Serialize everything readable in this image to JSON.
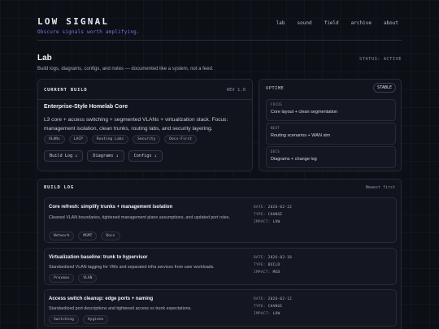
{
  "header": {
    "brand": "LOW SIGNAL",
    "tagline": "Obscure signals worth amplifying.",
    "nav": [
      "lab",
      "sound",
      "field",
      "archive",
      "about"
    ]
  },
  "page": {
    "title": "Lab",
    "subtitle": "Build logs, diagrams, configs, and notes — documented like a system, not a feed.",
    "status": "STATUS: ACTIVE"
  },
  "current_build": {
    "label": "CURRENT BUILD",
    "version": "REV 1.0",
    "title": "Enterprise-Style Homelab Core",
    "description": "L3 core + access switching + segmented VLANs + virtualization stack. Focus: management isolation, clean trunks, routing labs, and security layering.",
    "tags": [
      "VLANs",
      "LACP",
      "Routing Labs",
      "Security",
      "Docs-First"
    ],
    "buttons": [
      "Build Log ↓",
      "Diagrams ↓",
      "Configs ↓"
    ]
  },
  "uptime": {
    "label": "UPTIME",
    "badge": "STABLE",
    "cards": [
      {
        "key": "FOCUS",
        "value": "Core layout + clean segmentation"
      },
      {
        "key": "NEXT",
        "value": "Routing scenarios + WAN sim"
      },
      {
        "key": "DOCS",
        "value": "Diagrams + change log"
      }
    ]
  },
  "build_log": {
    "label": "BUILD LOG",
    "sort": "Newest first",
    "entries": [
      {
        "title": "Core refresh: simplify trunks + management isolation",
        "description": "Cleaned VLAN boundaries, tightened management plane assumptions, and updated port roles.",
        "tags": [
          "Network",
          "MGMT",
          "Docs"
        ],
        "date_label": "DATE:",
        "date": "2026-02-22",
        "type_label": "TYPE:",
        "type": "CHANGE",
        "impact_label": "IMPACT:",
        "impact": "LOW"
      },
      {
        "title": "Virtualization baseline: trunk to hypervisor",
        "description": "Standardized VLAN tagging for VMs and separated infra services from user workloads.",
        "tags": [
          "Proxmox",
          "VLAN"
        ],
        "date_label": "DATE:",
        "date": "2026-02-18",
        "type_label": "TYPE:",
        "type": "BUILD",
        "impact_label": "IMPACT:",
        "impact": "MED"
      },
      {
        "title": "Access switch cleanup: edge ports + naming",
        "description": "Standardized port descriptions and tightened access vs trunk expectations.",
        "tags": [
          "Switching",
          "Hygiene"
        ],
        "date_label": "DATE:",
        "date": "2026-02-12",
        "type_label": "TYPE:",
        "type": "CHANGE",
        "impact_label": "IMPACT:",
        "impact": "LOW"
      }
    ]
  }
}
